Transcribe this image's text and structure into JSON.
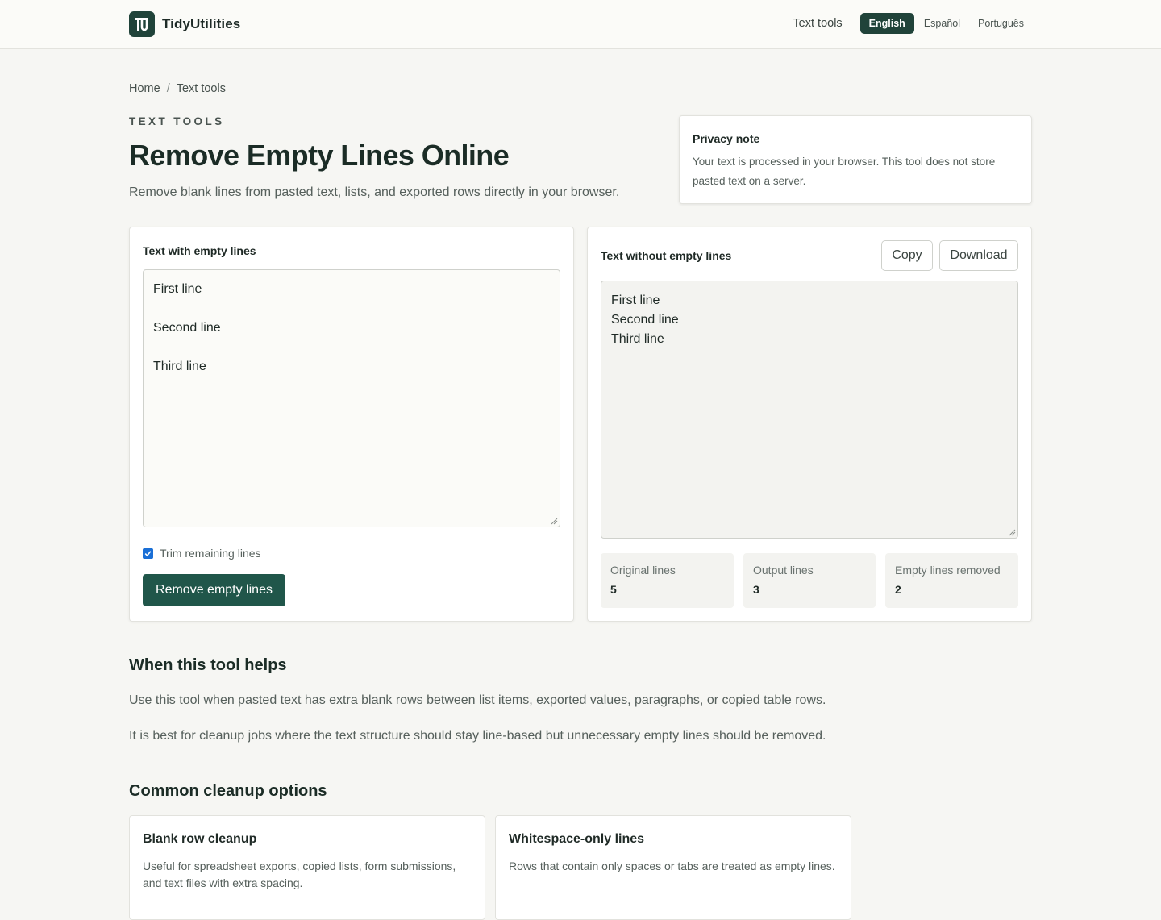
{
  "header": {
    "brand": "TidyUtilities",
    "nav_link": "Text tools",
    "languages": [
      "English",
      "Español",
      "Português"
    ],
    "active_language": "English"
  },
  "breadcrumb": {
    "home": "Home",
    "separator": "/",
    "current": "Text tools"
  },
  "hero": {
    "eyebrow": "TEXT TOOLS",
    "title": "Remove Empty Lines Online",
    "subtitle": "Remove blank lines from pasted text, lists, and exported rows directly in your browser."
  },
  "privacy": {
    "title": "Privacy note",
    "text": "Your text is processed in your browser. This tool does not store pasted text on a server."
  },
  "input_panel": {
    "label": "Text with empty lines",
    "lines": [
      "First line",
      "",
      "Second line",
      "",
      "Third line"
    ],
    "trim_label": "Trim remaining lines",
    "trim_checked": true,
    "button": "Remove empty lines"
  },
  "output_panel": {
    "label": "Text without empty lines",
    "copy": "Copy",
    "download": "Download",
    "lines": [
      "First line",
      "Second line",
      "Third line"
    ],
    "stats": [
      {
        "label": "Original lines",
        "value": "5"
      },
      {
        "label": "Output lines",
        "value": "3"
      },
      {
        "label": "Empty lines removed",
        "value": "2"
      }
    ]
  },
  "helps": {
    "heading": "When this tool helps",
    "p1": "Use this tool when pasted text has extra blank rows between list items, exported values, paragraphs, or copied table rows.",
    "p2": "It is best for cleanup jobs where the text structure should stay line-based but unnecessary empty lines should be removed."
  },
  "options": {
    "heading": "Common cleanup options",
    "cards": [
      {
        "title": "Blank row cleanup",
        "text": "Useful for spreadsheet exports, copied lists, form submissions, and text files with extra spacing."
      },
      {
        "title": "Whitespace-only lines",
        "text": "Rows that contain only spaces or tabs are treated as empty lines."
      }
    ]
  },
  "colors": {
    "accent": "#20433a",
    "button": "#20564a",
    "checkbox": "#1a6fd6"
  }
}
